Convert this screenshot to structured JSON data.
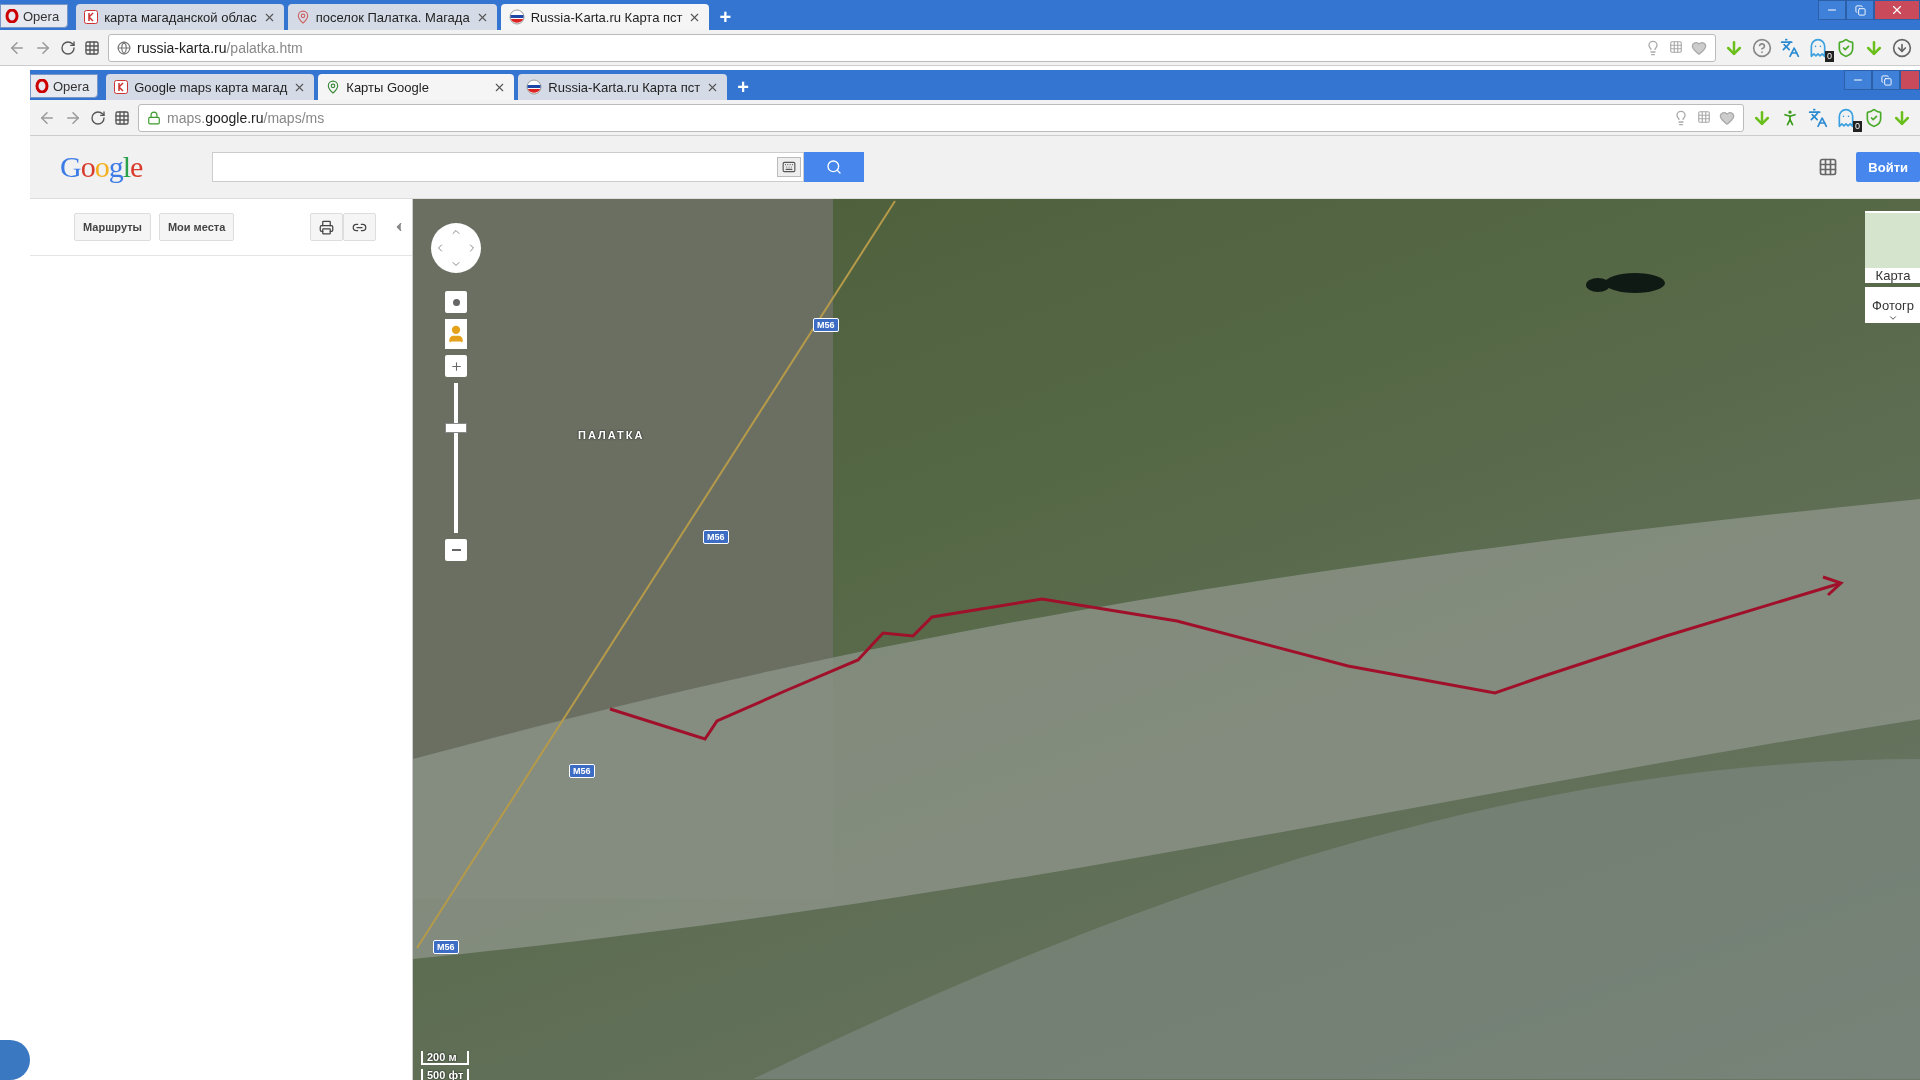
{
  "outer_browser": {
    "menu": "Opera",
    "tabs": [
      {
        "label": "карта магаданской облас",
        "selected": false
      },
      {
        "label": "поселок Палатка. Магада",
        "selected": false
      },
      {
        "label": "Russia-Karta.ru Карта пст",
        "selected": true
      }
    ],
    "new_tab": "+",
    "address": {
      "domain": "russia-karta.ru",
      "path": "/palatka.htm",
      "secure": false
    },
    "extensions": [
      {
        "kind": "download"
      },
      {
        "kind": "help"
      },
      {
        "kind": "translate"
      },
      {
        "kind": "ghost",
        "badge": "0"
      },
      {
        "kind": "shield"
      },
      {
        "kind": "download"
      },
      {
        "kind": "download-circle"
      }
    ]
  },
  "inner_browser": {
    "menu": "Opera",
    "tabs": [
      {
        "label": "Google maps карта магад",
        "selected": false
      },
      {
        "label": "Карты Google",
        "selected": true
      },
      {
        "label": "Russia-Karta.ru Карта пст",
        "selected": false
      }
    ],
    "new_tab": "+",
    "address": {
      "prefix": "maps.",
      "domain": "google.ru",
      "path": "/maps/ms",
      "secure": true
    },
    "extensions": [
      {
        "kind": "download"
      },
      {
        "kind": "walker"
      },
      {
        "kind": "translate"
      },
      {
        "kind": "ghost",
        "badge": "0"
      },
      {
        "kind": "shield"
      },
      {
        "kind": "download"
      }
    ]
  },
  "google": {
    "logo": "Google",
    "sign_in": "Войти"
  },
  "sidebar": {
    "buttons": [
      "Маршруты",
      "Мои места"
    ]
  },
  "map": {
    "zoom": {
      "level": 0.7
    },
    "place_label": "ПАЛАТКА",
    "road_labels": [
      "M56",
      "M56",
      "M56",
      "M56"
    ],
    "layers": [
      "Карта",
      "Фотогр"
    ],
    "scale": [
      "200 м",
      "500 фт"
    ]
  }
}
